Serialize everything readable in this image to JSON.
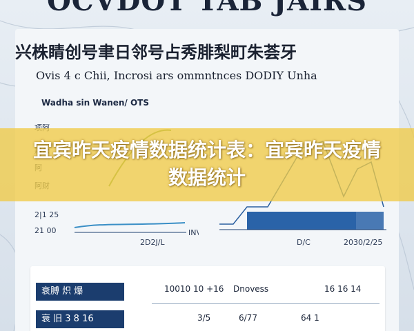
{
  "top_title": "OCVDOT TAB JAIRS",
  "header": {
    "line1": "兴株睛创号聿日邻号占秀腓梨町朱荟牙",
    "line2": "Ovis 4 c Chii, Incrosi ars ommntnces DODIY Unha",
    "line3": "Wadha sin Wanen/ OTS"
  },
  "left_chart": {
    "y_labels": [
      "项阿",
      "耕尔",
      "阿",
      "阿财",
      "2|1 25",
      "21 00"
    ],
    "x_label": "2D2J/L",
    "x_label_right": "INV",
    "series_color": "#3a8fc6",
    "accent_color": "#7aa23a"
  },
  "right_chart": {
    "x_labels": [
      "D/C",
      "2030/2/25"
    ],
    "line_color": "#2a5fa0",
    "bar_color": "#2a63a8"
  },
  "table": {
    "headers": [
      "10010 10 +16",
      "Dnovess",
      "16 16 14"
    ],
    "row_labels": [
      "衰膊 炽 爆",
      "衰 旧 3 8 16"
    ],
    "row2_values": [
      "3/5",
      "6/77",
      "64 1"
    ]
  },
  "overlay": {
    "text": "宜宾昨天疫情数据统计表：宜宾昨天疫情数据统计"
  }
}
